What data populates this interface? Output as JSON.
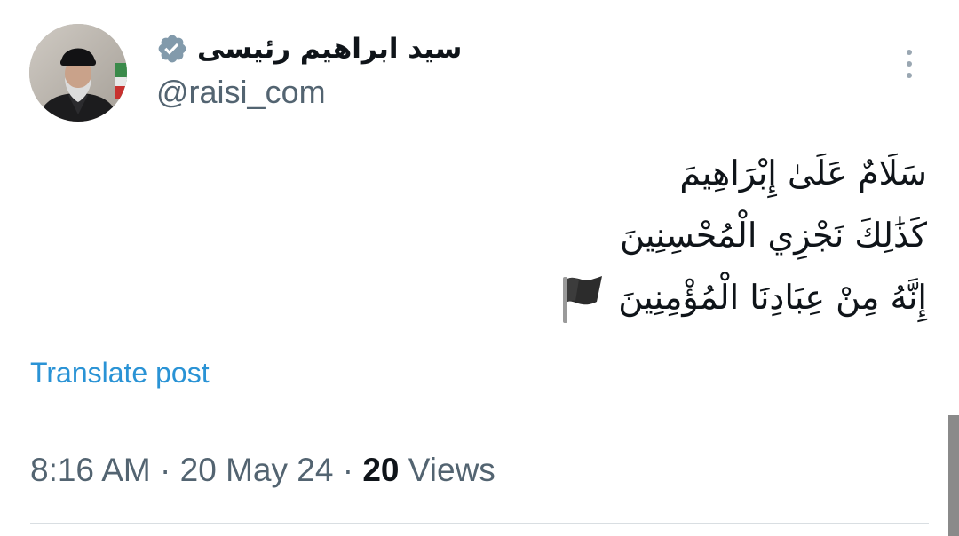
{
  "author": {
    "display_name": "سید ابراهیم رئیسی",
    "handle": "@raisi_com",
    "verified": true,
    "avatar_icon": "profile-photo"
  },
  "tweet": {
    "lines": [
      "سَلَامٌ عَلَىٰ إِبْرَاهِيمَ",
      "كَذَٰلِكَ نَجْزِي الْمُحْسِنِينَ",
      "إِنَّهُ مِنْ عِبَادِنَا الْمُؤْمِنِينَ"
    ],
    "trailing_emoji": "black-flag-icon"
  },
  "translate_label": "Translate post",
  "meta": {
    "time": "8:16 AM",
    "separator": " · ",
    "date": "20 May 24",
    "views_count": "20",
    "views_label": " Views"
  },
  "colors": {
    "link": "#2a93d5",
    "secondary_text": "#536471",
    "verified_badge": "#829aab"
  }
}
